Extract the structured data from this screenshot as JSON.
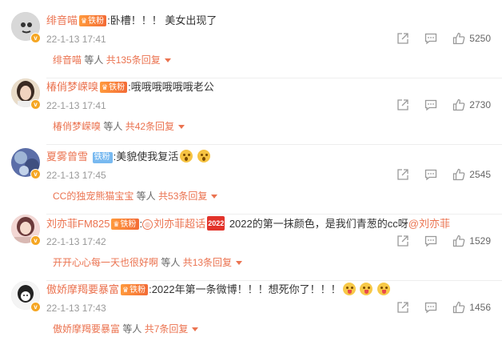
{
  "comments": [
    {
      "username": "绯音喵",
      "fan_badge": "铁粉",
      "fan_badge_style": "red",
      "text": ":卧槽！！！ 美女出现了",
      "time": "22-1-13 17:41",
      "likes": "5250",
      "reply_user": "绯音喵",
      "reply_mid": " 等人 ",
      "reply_count": "共135条回复",
      "avatar_colors": [
        "#d8d8d8",
        "#333333"
      ]
    },
    {
      "username": "椿俏梦嵘嗅",
      "fan_badge": "铁粉",
      "fan_badge_style": "red",
      "text": ":哦哦哦哦哦哦老公",
      "time": "22-1-13 17:41",
      "likes": "2730",
      "reply_user": "椿俏梦嵘嗅",
      "reply_mid": " 等人 ",
      "reply_count": "共42条回复",
      "avatar_colors": [
        "#e9dcc9",
        "#3a2a22"
      ]
    },
    {
      "username": "夏雾曾雪",
      "fan_badge": "铁粉",
      "fan_badge_style": "blue",
      "text": ":美貌使我复活",
      "time": "22-1-13 17:45",
      "likes": "2545",
      "reply_user": "CC的独宠熊猫宝宝",
      "reply_mid": " 等人 ",
      "reply_count": "共53条回复",
      "avatar_colors": [
        "#5b6ea8",
        "#9fb6d6"
      ]
    },
    {
      "username": "刘亦菲FM825",
      "fan_badge": "铁粉",
      "fan_badge_style": "red",
      "text_prefix": ":",
      "hashtag": "刘亦菲超话",
      "badge_2022": "2022",
      "text": " 2022的第一抹颜色，是我们青葱的cc呀",
      "mention": "@刘亦菲",
      "time": "22-1-13 17:42",
      "likes": "1529",
      "reply_user": "开开心心每一天也很好啊",
      "reply_mid": " 等人 ",
      "reply_count": "共13条回复",
      "avatar_colors": [
        "#f3d7d4",
        "#6b3a3a"
      ]
    },
    {
      "username": "傲娇摩羯要暴富",
      "fan_badge": "铁粉",
      "fan_badge_style": "red",
      "text": ":2022年第一条微博！！！想死你了！！！",
      "time": "22-1-13 17:43",
      "likes": "1456",
      "reply_user": "傲娇摩羯要暴富",
      "reply_mid": " 等人 ",
      "reply_count": "共7条回复",
      "avatar_colors": [
        "#f4f4f4",
        "#222222"
      ]
    }
  ],
  "icons": {
    "share": "share-icon",
    "comment": "comment-icon",
    "like": "thumbs-up-icon",
    "verified": "verified-badge-icon"
  },
  "colors": {
    "username": "#eb7350",
    "time": "#999999",
    "text": "#333333"
  }
}
